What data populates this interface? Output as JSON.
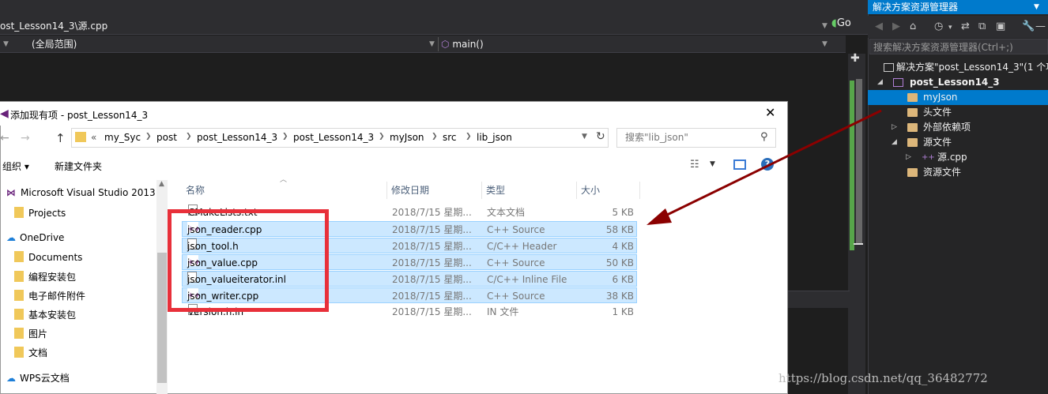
{
  "vs": {
    "tab_path": "ost_Lesson14_3\\源.cpp",
    "go_label": "Go",
    "scope": "(全局范围)",
    "function": "main()"
  },
  "solution_explorer": {
    "title": "解决方案资源管理器",
    "search_placeholder": "搜索解决方案资源管理器(Ctrl+;)",
    "solution": "解决方案\"post_Lesson14_3\"(1 个项",
    "project": "post_Lesson14_3",
    "items": [
      "myJson",
      "头文件",
      "外部依赖项",
      "源文件",
      "源.cpp",
      "资源文件"
    ]
  },
  "dialog": {
    "title": "添加现有项 - post_Lesson14_3",
    "breadcrumbs": [
      "my_Syc",
      "post",
      "post_Lesson14_3",
      "post_Lesson14_3",
      "myJson",
      "src",
      "lib_json"
    ],
    "search_placeholder": "搜索\"lib_json\"",
    "organize": "组织 ▾",
    "new_folder": "新建文件夹",
    "nav_items": [
      "Microsoft Visual Studio 2013",
      "Projects",
      "OneDrive",
      "Documents",
      "编程安装包",
      "电子邮件附件",
      "基本安装包",
      "图片",
      "文档",
      "WPS云文档"
    ],
    "columns": [
      "名称",
      "修改日期",
      "类型",
      "大小"
    ],
    "files": [
      {
        "name": "CMakeLists.txt",
        "date": "2018/7/15 星期...",
        "type": "文本文档",
        "size": "5 KB"
      },
      {
        "name": "json_reader.cpp",
        "date": "2018/7/15 星期...",
        "type": "C++ Source",
        "size": "58 KB"
      },
      {
        "name": "json_tool.h",
        "date": "2018/7/15 星期...",
        "type": "C/C++ Header",
        "size": "4 KB"
      },
      {
        "name": "json_value.cpp",
        "date": "2018/7/15 星期...",
        "type": "C++ Source",
        "size": "50 KB"
      },
      {
        "name": "json_valueiterator.inl",
        "date": "2018/7/15 星期...",
        "type": "C/C++ Inline File",
        "size": "6 KB"
      },
      {
        "name": "json_writer.cpp",
        "date": "2018/7/15 星期...",
        "type": "C++ Source",
        "size": "38 KB"
      },
      {
        "name": "version.h.in",
        "date": "2018/7/15 星期...",
        "type": "IN 文件",
        "size": "1 KB"
      }
    ]
  },
  "watermark": "https://blog.csdn.net/qq_36482772"
}
